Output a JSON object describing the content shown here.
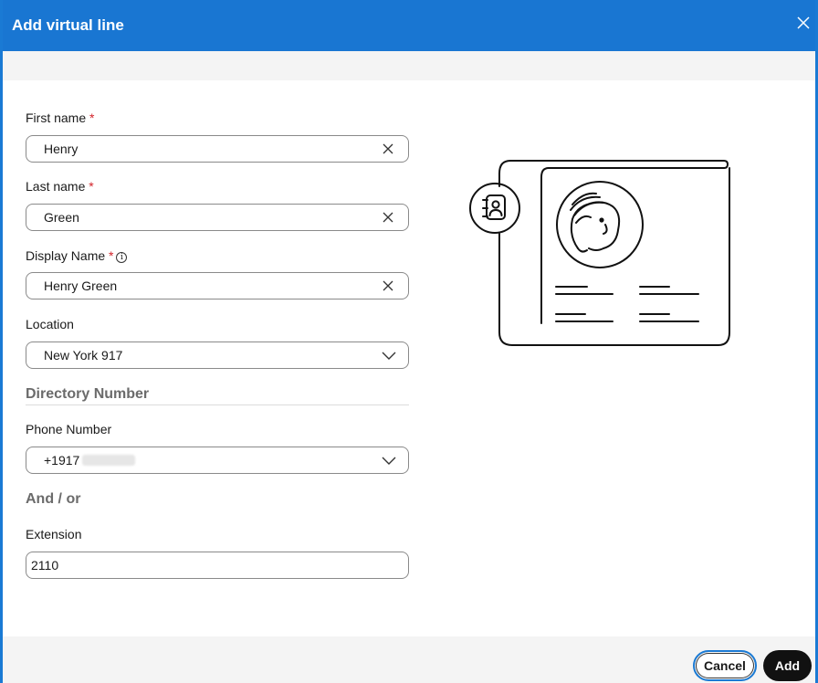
{
  "dialog": {
    "title": "Add virtual line",
    "close_icon": "close-icon"
  },
  "form": {
    "first_name": {
      "label": "First name",
      "required": "*",
      "value": "Henry"
    },
    "last_name": {
      "label": "Last name",
      "required": "*",
      "value": "Green"
    },
    "display_name": {
      "label": "Display Name",
      "required": "*",
      "info_icon": "info-icon",
      "value": "Henry Green"
    },
    "location": {
      "label": "Location",
      "value": "New York 917"
    },
    "directory_section": "Directory Number",
    "phone_number": {
      "label": "Phone Number",
      "value": "+1917"
    },
    "and_or": "And / or",
    "extension": {
      "label": "Extension",
      "value": "2110"
    }
  },
  "illustration": {
    "icon": "contact-card-illustration"
  },
  "footer": {
    "cancel_label": "Cancel",
    "add_label": "Add"
  },
  "colors": {
    "titlebar": "#1976d2",
    "required": "#d2232a",
    "primary_button": "#111111"
  }
}
